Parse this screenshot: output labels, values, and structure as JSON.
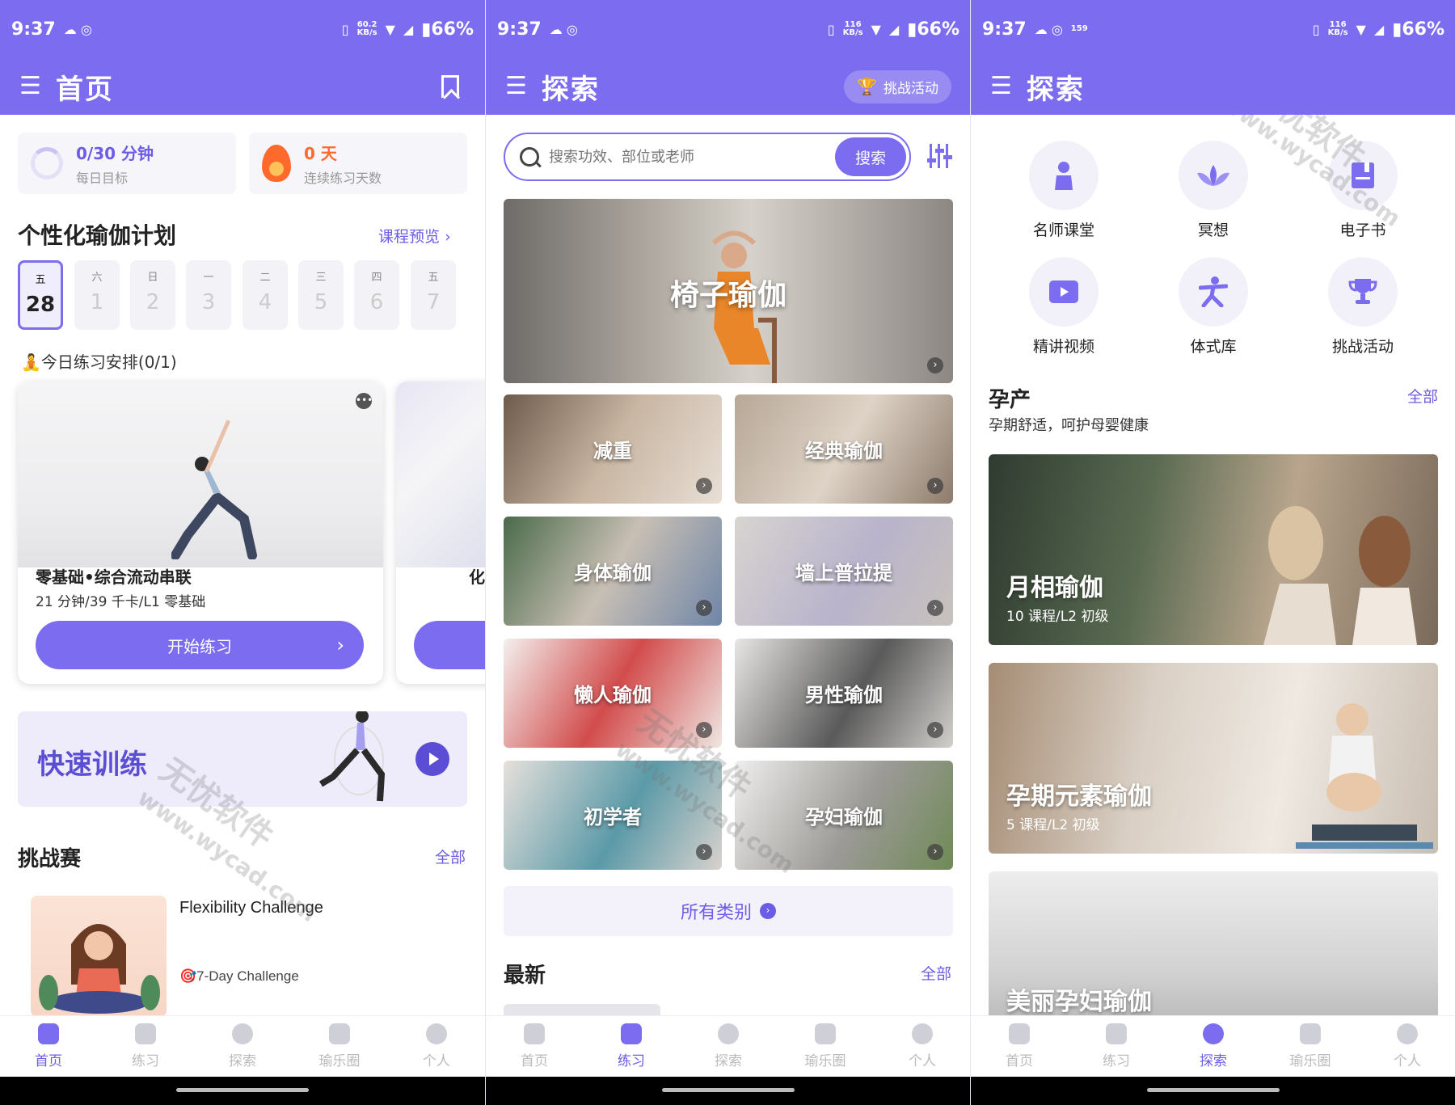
{
  "colors": {
    "primary": "#7b6cf0",
    "accent": "#6c5ce7",
    "orange": "#ff6a2c"
  },
  "screens": [
    {
      "status": {
        "time": "9:37",
        "speed_top": "60.2",
        "speed_unit": "KB/s",
        "battery": "66%"
      },
      "appbar": {
        "title": "首页",
        "action_icon": "bookmark-icon"
      },
      "stats": [
        {
          "main": "0/30 分钟",
          "sub": "每日目标"
        },
        {
          "main": "0 天",
          "sub": "连续练习天数"
        }
      ],
      "plan": {
        "title": "个性化瑜伽计划",
        "preview_link": "课程预览",
        "days": [
          {
            "dow": "五",
            "num": "28"
          },
          {
            "dow": "六",
            "num": "1"
          },
          {
            "dow": "日",
            "num": "2"
          },
          {
            "dow": "一",
            "num": "3"
          },
          {
            "dow": "二",
            "num": "4"
          },
          {
            "dow": "三",
            "num": "5"
          },
          {
            "dow": "四",
            "num": "6"
          },
          {
            "dow": "五",
            "num": "7"
          }
        ],
        "today_line": "🧘今日练习安排(0/1)",
        "card_title": "零基础•综合流动串联",
        "card_meta": "21 分钟/39 千卡/L1 零基础",
        "start_label": "开始练习",
        "card2_peek": "化"
      },
      "quick": {
        "title": "快速训练"
      },
      "challenges": {
        "title": "挑战赛",
        "all_link": "全部",
        "item_title": "Flexibility Challenge",
        "item_sub": "🎯7-Day Challenge"
      },
      "nav_active": 0
    },
    {
      "status": {
        "time": "9:37",
        "speed_top": "116",
        "speed_unit": "KB/s",
        "battery": "66%"
      },
      "appbar": {
        "title": "探索",
        "pill": "挑战活动"
      },
      "search": {
        "placeholder": "搜索功效、部位或老师",
        "button": "搜索"
      },
      "hero": "椅子瑜伽",
      "categories": [
        "减重",
        "经典瑜伽",
        "身体瑜伽",
        "墙上普拉提",
        "懒人瑜伽",
        "男性瑜伽",
        "初学者",
        "孕妇瑜伽"
      ],
      "all_categories": "所有类别",
      "latest": {
        "title": "最新",
        "all_link": "全部"
      },
      "nav_active": 1
    },
    {
      "status": {
        "time": "9:37",
        "speed_top": "116",
        "speed_unit": "KB/s",
        "extra_speed": "159",
        "battery": "66%"
      },
      "appbar": {
        "title": "探索"
      },
      "features": [
        {
          "label": "名师课堂",
          "icon": "teacher-icon"
        },
        {
          "label": "冥想",
          "icon": "lotus-icon"
        },
        {
          "label": "电子书",
          "icon": "ebook-icon"
        },
        {
          "label": "精讲视频",
          "icon": "video-icon"
        },
        {
          "label": "体式库",
          "icon": "pose-icon"
        },
        {
          "label": "挑战活动",
          "icon": "trophy-icon"
        }
      ],
      "prenatal": {
        "title": "孕产",
        "all_link": "全部",
        "subtitle": "孕期舒适，呵护母婴健康",
        "courses": [
          {
            "title": "月相瑜伽",
            "meta": "10 课程/L2 初级"
          },
          {
            "title": "孕期元素瑜伽",
            "meta": "5 课程/L2 初级"
          },
          {
            "title": "美丽孕妇瑜伽",
            "meta": ""
          }
        ]
      },
      "nav_active": 2
    }
  ],
  "nav": [
    "首页",
    "练习",
    "探索",
    "瑜乐圈",
    "个人"
  ],
  "watermark": {
    "cn": "无忧软件",
    "url": "www.wycad.com"
  }
}
